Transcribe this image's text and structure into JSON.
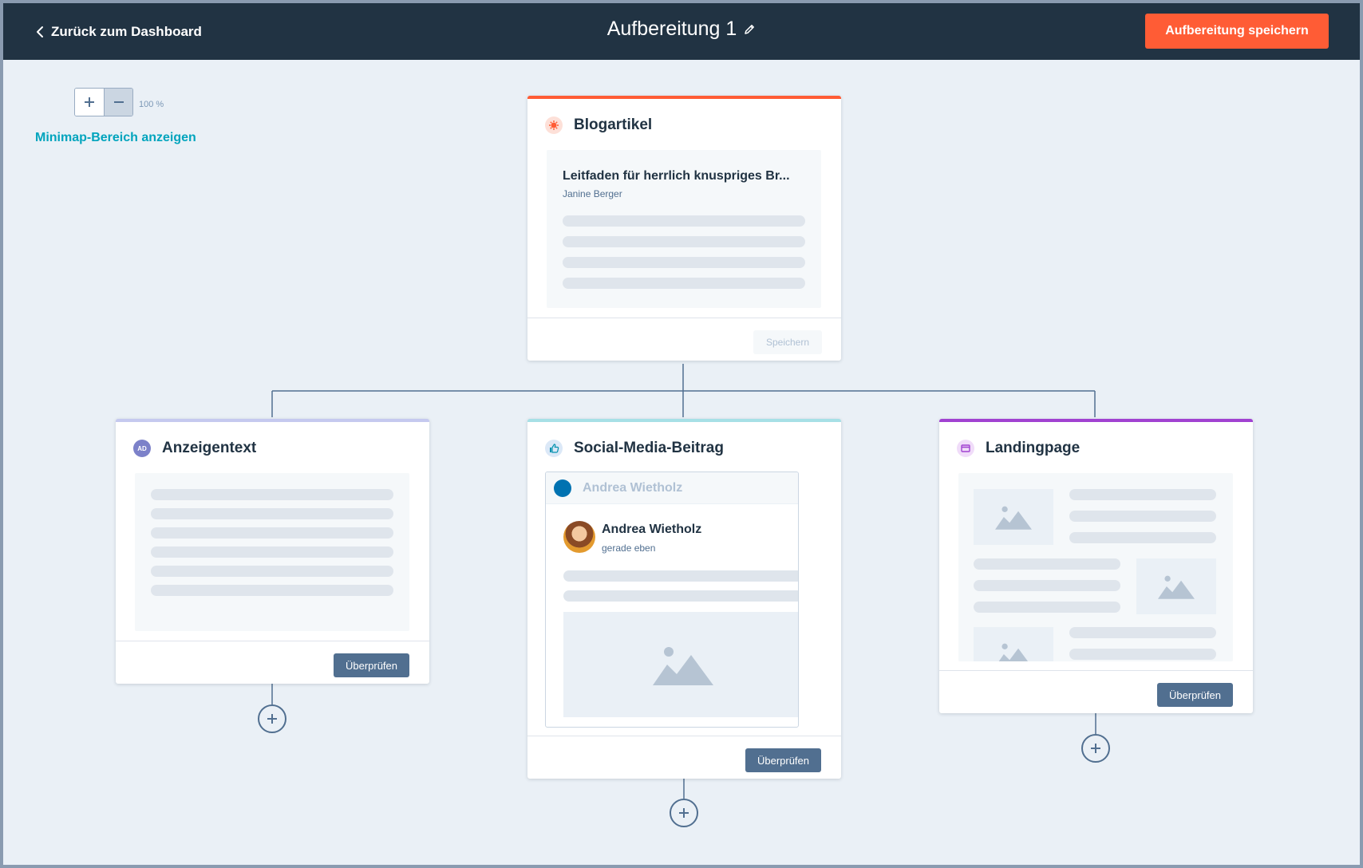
{
  "header": {
    "back_label": "Zurück zum Dashboard",
    "title": "Aufbereitung 1",
    "save_label": "Aufbereitung speichern"
  },
  "toolbar": {
    "zoom_level": "100 %",
    "minimap_label": "Minimap-Bereich anzeigen"
  },
  "blog": {
    "title": "Blogartikel",
    "headline": "Leitfaden für herrlich knuspriges Br...",
    "author": "Janine Berger",
    "save_label": "Speichern"
  },
  "ad": {
    "title": "Anzeigentext",
    "icon_text": "AD",
    "review_label": "Überprüfen"
  },
  "social": {
    "title": "Social-Media-Beitrag",
    "account_name": "Andrea Wietholz",
    "post_author": "Andrea Wietholz",
    "post_time": "gerade eben",
    "review_label": "Überprüfen"
  },
  "landing": {
    "title": "Landingpage",
    "review_label": "Überprüfen"
  },
  "colors": {
    "topbar": "#213343",
    "accent": "#ff5c35",
    "link": "#00a4bd",
    "ad_accent": "#c5c9ef",
    "social_accent": "#a7e0e6",
    "landing_accent": "#a142d1"
  }
}
